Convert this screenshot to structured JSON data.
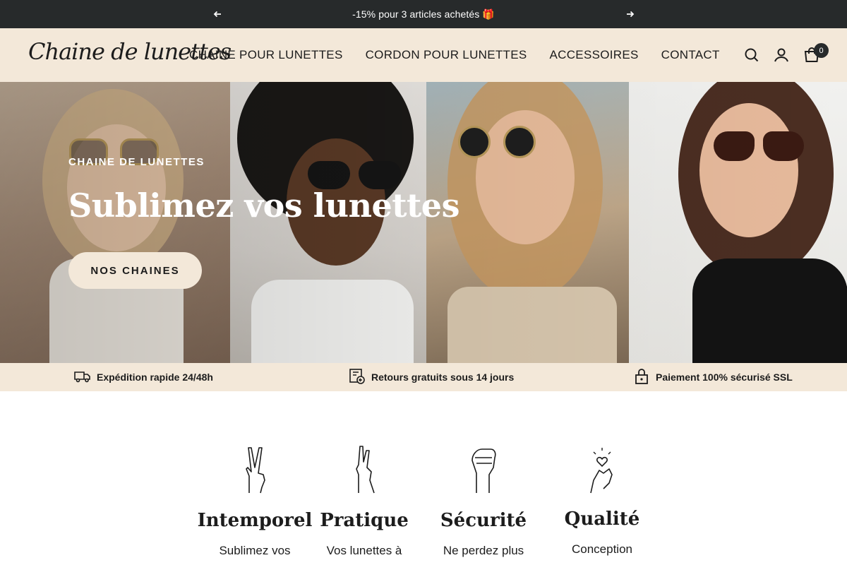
{
  "announcement": {
    "message": "-15% pour 3 articles achetés 🎁",
    "prev_icon": "arrow-left-icon",
    "next_icon": "arrow-right-icon"
  },
  "header": {
    "logo": "Chaine de lunettes",
    "nav": [
      {
        "label": "CHAINE POUR LUNETTES"
      },
      {
        "label": "CORDON POUR LUNETTES"
      },
      {
        "label": "ACCESSOIRES"
      },
      {
        "label": "CONTACT"
      }
    ],
    "icons": [
      "search-icon",
      "account-icon",
      "cart-icon"
    ],
    "cart_count": "0"
  },
  "hero": {
    "eyebrow": "CHAINE DE LUNETTES",
    "title": "Sublimez vos lunettes",
    "button_label": "NOS CHAINES"
  },
  "trust_bar": [
    {
      "icon": "truck-icon",
      "label": "Expédition rapide 24/48h"
    },
    {
      "icon": "return-icon",
      "label": "Retours gratuits sous 14 jours"
    },
    {
      "icon": "lock-icon",
      "label": "Paiement 100% sécurisé SSL"
    }
  ],
  "features": [
    {
      "icon": "peace-hand-icon",
      "title": "Intemporel",
      "text": "Sublimez vos"
    },
    {
      "icon": "crossed-fingers-icon",
      "title": "Pratique",
      "text": "Vos lunettes à"
    },
    {
      "icon": "fist-icon",
      "title": "Sécurité",
      "text": "Ne perdez plus"
    },
    {
      "icon": "finger-heart-icon",
      "title": "Qualité",
      "text": "Conception"
    }
  ],
  "colors": {
    "announcement_bg": "#272a2b",
    "header_bg": "#f3e8d9",
    "text": "#1c1c1c"
  }
}
